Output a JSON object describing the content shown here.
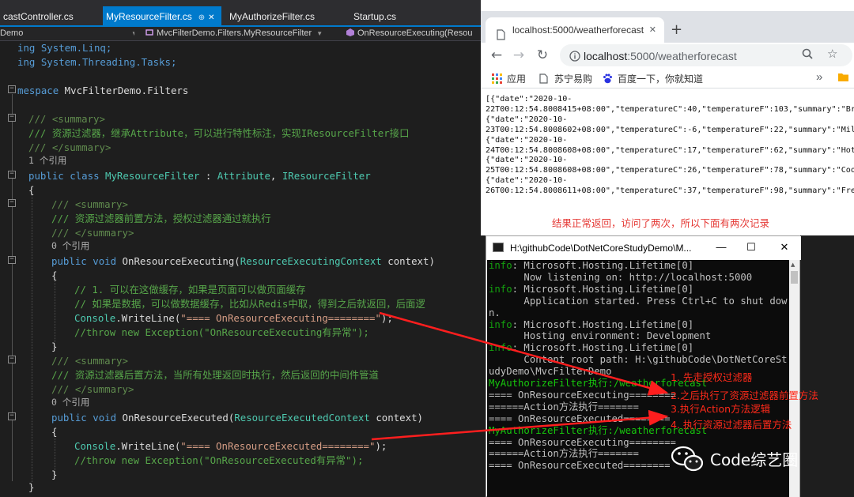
{
  "vs": {
    "tabs": [
      {
        "label": "castController.cs"
      },
      {
        "label": "MyResourceFilter.cs",
        "pin": "⊕",
        "close": "✕"
      },
      {
        "label": "MyAuthorizeFilter.cs"
      },
      {
        "label": "Startup.cs"
      }
    ],
    "nav": {
      "project": "Demo",
      "class": "MvcFilterDemo.Filters.MyResourceFilter",
      "member": "OnResourceExecuting(Resou"
    },
    "code": {
      "using_linq": "ing System.Linq;",
      "using_tasks": "ing System.Threading.Tasks;",
      "ns_kw": "mespace",
      "ns_name": " MvcFilterDemo.Filters",
      "doc1_open": "/// <summary>",
      "doc1_text": "/// 资源过滤器，继承Attribute，可以进行特性标注，实现IResourceFilter接口",
      "doc1_close": "/// </summary>",
      "ref_class": "1 个引用",
      "class_kw1": "public",
      "class_kw2": "class",
      "class_name": "MyResourceFilter",
      "class_sep1": " : ",
      "class_base1": "Attribute",
      "class_sep2": ", ",
      "class_base2": "IResourceFilter",
      "brace_open": "{",
      "doc2_open": "/// <summary>",
      "doc2_text": "/// 资源过滤器前置方法，授权过滤器通过就执行",
      "doc2_close": "/// </summary>",
      "ref_m1": "0 个引用",
      "m1_kw1": "public",
      "m1_kw2": "void",
      "m1_name": " OnResourceExecuting(",
      "m1_ptype": "ResourceExecutingContext",
      "m1_pname": " context)",
      "m1_open": "{",
      "c1": "// 1. 可以在这做缓存，如果是页面可以做页面缓存",
      "c2": "// 如果是数据，可以做数据缓存，比如从Redis中取，得到之后就返回，后面逻",
      "m1_write_cls": "Console",
      "m1_write_call": ".WriteLine(",
      "m1_write_str": "\"==== OnResourceExecuting========\"",
      "m1_write_end": ");",
      "m1_throw": "//throw new Exception(\"OnResourceExecuting有异常\");",
      "m1_close": "}",
      "doc3_open": "/// <summary>",
      "doc3_text": "/// 资源过滤器后置方法，当所有处理返回时执行，然后返回的中间件管道",
      "doc3_close": "/// </summary>",
      "ref_m2": "0 个引用",
      "m2_kw1": "public",
      "m2_kw2": "void",
      "m2_name": " OnResourceExecuted(",
      "m2_ptype": "ResourceExecutedContext",
      "m2_pname": " context)",
      "m2_open": "{",
      "m2_write_cls": "Console",
      "m2_write_call": ".WriteLine(",
      "m2_write_str": "\"==== OnResourceExecuted========\"",
      "m2_write_end": ");",
      "m2_throw": "//throw new Exception(\"OnResourceExecuted有异常\");",
      "m2_close": "}",
      "class_close": "}"
    }
  },
  "browser": {
    "tab_title": "localhost:5000/weatherforecast",
    "tab_close": "✕",
    "new_tab": "+",
    "url_host": "localhost",
    "url_rest": ":5000/weatherforecast",
    "bookmarks": [
      "应用",
      "苏宁易购",
      "百度一下，你就知道"
    ],
    "more": "»",
    "json_lines": [
      "[{\"date\":\"2020-10-",
      "22T00:12:54.8008415+08:00\",\"temperatureC\":40,\"temperatureF\":103,\"summary\":\"Bracing\"},",
      "{\"date\":\"2020-10-",
      "23T00:12:54.8008602+08:00\",\"temperatureC\":-6,\"temperatureF\":22,\"summary\":\"Mild\"},",
      "{\"date\":\"2020-10-",
      "24T00:12:54.8008608+08:00\",\"temperatureC\":17,\"temperatureF\":62,\"summary\":\"Hot\"},",
      "{\"date\":\"2020-10-",
      "25T00:12:54.8008608+08:00\",\"temperatureC\":26,\"temperatureF\":78,\"summary\":\"Cool\"},",
      "{\"date\":\"2020-10-",
      "26T00:12:54.8008611+08:00\",\"temperatureC\":37,\"temperatureF\":98,\"summary\":\"Freezing\"}]"
    ],
    "note": "结果正常返回，访问了两次，所以下面有两次记录"
  },
  "console": {
    "title": "H:\\githubCode\\DotNetCoreStudyDemo\\M...",
    "minimize": "—",
    "maximize": "☐",
    "close": "✕",
    "lines": [
      {
        "prefix": "info",
        "text": ": Microsoft.Hosting.Lifetime[0]"
      },
      {
        "prefix": "",
        "text": "      Now listening on: http://localhost:5000"
      },
      {
        "prefix": "info",
        "text": ": Microsoft.Hosting.Lifetime[0]"
      },
      {
        "prefix": "",
        "text": "      Application started. Press Ctrl+C to shut dow"
      },
      {
        "prefix": "",
        "text": "n."
      },
      {
        "prefix": "info",
        "text": ": Microsoft.Hosting.Lifetime[0]"
      },
      {
        "prefix": "",
        "text": "      Hosting environment: Development"
      },
      {
        "prefix": "info",
        "text": ": Microsoft.Hosting.Lifetime[0]"
      },
      {
        "prefix": "",
        "text": "      Content root path: H:\\githubCode\\DotNetCoreSt"
      },
      {
        "prefix": "",
        "text": "udyDemo\\MvcFilterDemo"
      },
      {
        "prefix": "",
        "text": "MyAuthorizeFilter执行:/weatherforecast",
        "green": true
      },
      {
        "prefix": "",
        "text": "==== OnResourceExecuting========"
      },
      {
        "prefix": "",
        "text": "======Action方法执行======="
      },
      {
        "prefix": "",
        "text": "==== OnResourceExecuted========"
      },
      {
        "prefix": "",
        "text": "MyAuthorizeFilter执行:/weatherforecast",
        "green": true
      },
      {
        "prefix": "",
        "text": "==== OnResourceExecuting========"
      },
      {
        "prefix": "",
        "text": "======Action方法执行======="
      },
      {
        "prefix": "",
        "text": "==== OnResourceExecuted========"
      }
    ]
  },
  "annotations": [
    "1. 先走授权过滤器",
    "2.之后执行了资源过滤器前置方法",
    "3.执行Action方法逻辑",
    "4. 执行资源过滤器后置方法"
  ],
  "watermark": "Code综艺圈",
  "colors": {
    "annotation_red": "#ff2a1a",
    "vs_accent": "#007acc",
    "console_green": "#16c60c"
  }
}
